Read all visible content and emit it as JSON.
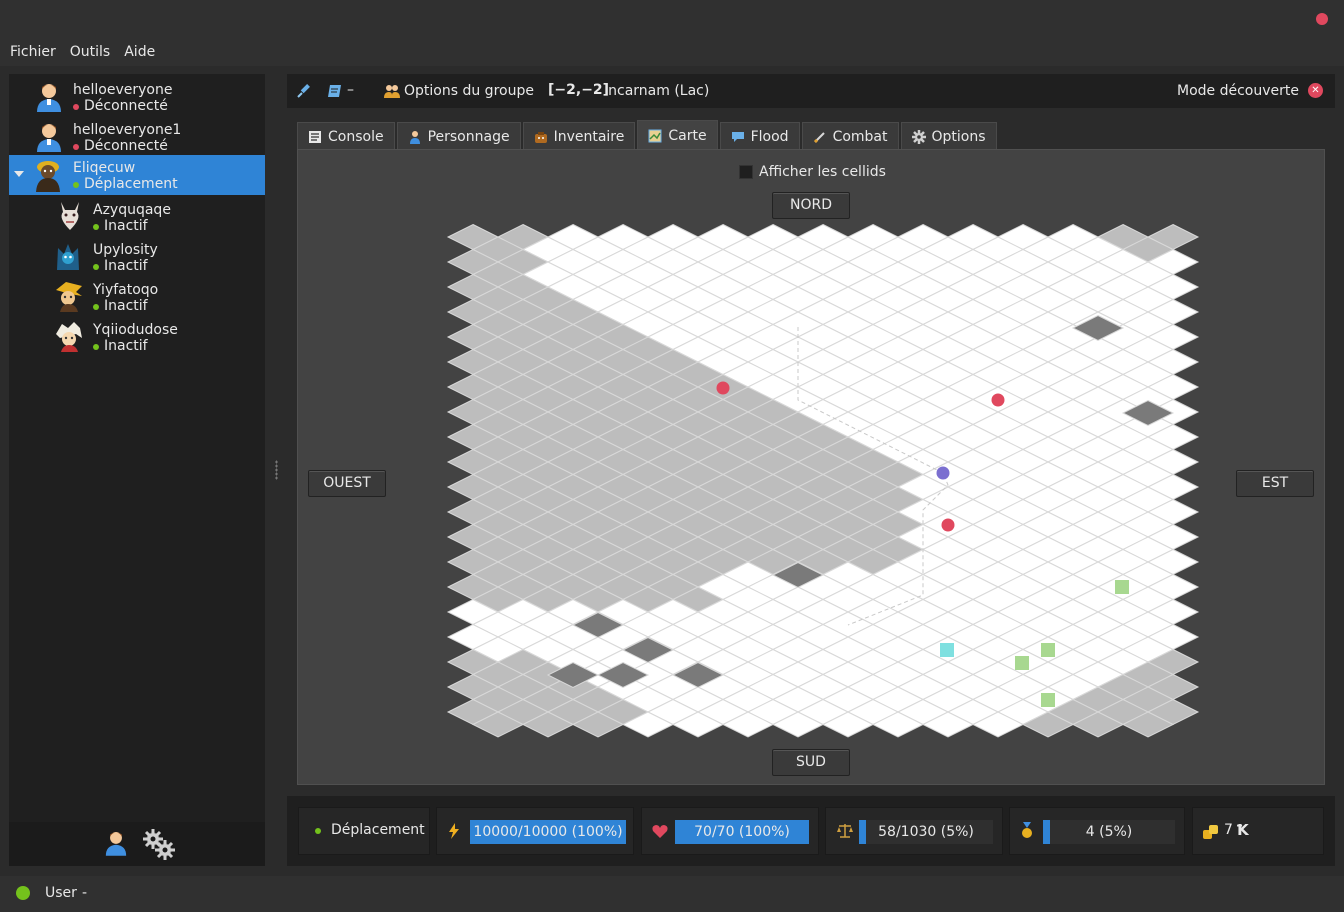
{
  "menu": [
    "Fichier",
    "Outils",
    "Aide"
  ],
  "accounts": [
    {
      "name": "helloeveryone",
      "status": "Déconnecté",
      "status_color": "#e0485e",
      "avatar": "user-avatar"
    },
    {
      "name": "helloeveryone1",
      "status": "Déconnecté",
      "status_color": "#e0485e",
      "avatar": "user-avatar"
    },
    {
      "name": "Eliqecuw",
      "status": "Déplacement",
      "status_color": "#74c21c",
      "avatar": "character-avatar",
      "selected": true
    },
    {
      "name": "Azyquqaqe",
      "status": "Inactif",
      "status_color": "#74c21c",
      "avatar": "character-avatar"
    },
    {
      "name": "Upylosity",
      "status": "Inactif",
      "status_color": "#74c21c",
      "avatar": "character-avatar"
    },
    {
      "name": "Yiyfatoqo",
      "status": "Inactif",
      "status_color": "#74c21c",
      "avatar": "character-avatar"
    },
    {
      "name": "Yqiiodudose",
      "status": "Inactif",
      "status_color": "#74c21c",
      "avatar": "character-avatar"
    }
  ],
  "header": {
    "dash": "–",
    "group_options": "Options du groupe",
    "coords": "[−2,−2]",
    "location": "Incarnam (Lac)",
    "mode": "Mode découverte"
  },
  "tabs": [
    {
      "label": "Console",
      "icon": "console-icon"
    },
    {
      "label": "Personnage",
      "icon": "character-icon"
    },
    {
      "label": "Inventaire",
      "icon": "bag-icon"
    },
    {
      "label": "Carte",
      "icon": "map-icon",
      "active": true
    },
    {
      "label": "Flood",
      "icon": "speech-bubble-icon"
    },
    {
      "label": "Combat",
      "icon": "sword-icon"
    },
    {
      "label": "Options",
      "icon": "gear-icon"
    }
  ],
  "map": {
    "show_cellids": "Afficher les cellids",
    "north": "NORD",
    "south": "SUD",
    "west": "OUEST",
    "east": "EST"
  },
  "status_bar": {
    "state": "Déplacement",
    "energy": {
      "text": "10000/10000 (100%)",
      "fraction": 1.0
    },
    "life": {
      "text": "70/70 (100%)",
      "fraction": 1.0
    },
    "weight": {
      "text": "58/1030 (5%)",
      "fraction": 0.05
    },
    "xp": {
      "text": "4 (5%)",
      "fraction": 0.05
    },
    "kamas": "7"
  },
  "footer": {
    "user": "User",
    "dash": "-"
  },
  "colors": {
    "accent": "#2f84d6",
    "offline": "#e0485e",
    "online": "#74c21c"
  }
}
